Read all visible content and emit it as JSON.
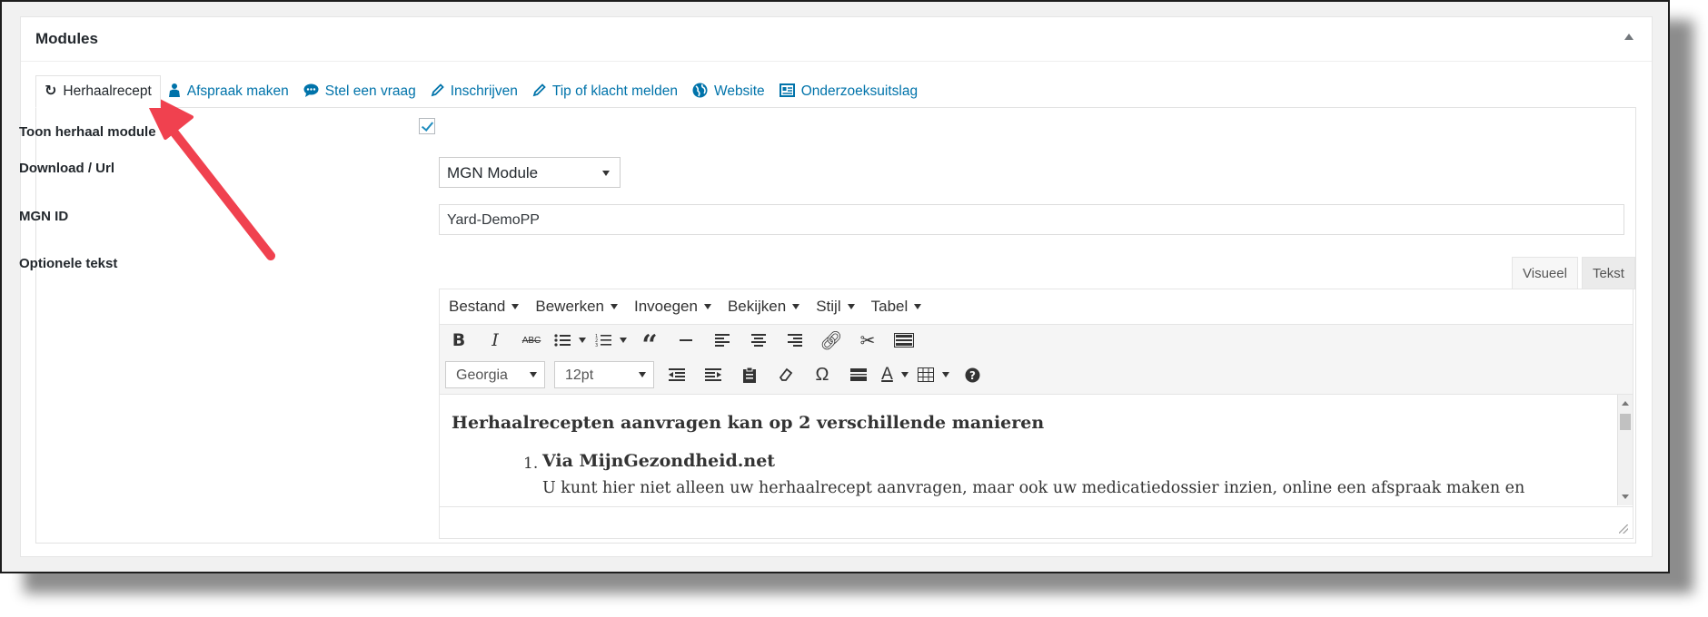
{
  "postbox": {
    "title": "Modules"
  },
  "tabs": [
    {
      "label": "Herhaalrecept",
      "icon": "refresh-icon"
    },
    {
      "label": "Afspraak maken",
      "icon": "person-icon"
    },
    {
      "label": "Stel een vraag",
      "icon": "chat-bubble-icon"
    },
    {
      "label": "Inschrijven",
      "icon": "pencil-icon"
    },
    {
      "label": "Tip of klacht melden",
      "icon": "pencil-icon"
    },
    {
      "label": "Website",
      "icon": "globe-icon"
    },
    {
      "label": "Onderzoeksuitslag",
      "icon": "document-icon"
    }
  ],
  "fields": {
    "toon": {
      "label": "Toon herhaal module",
      "checked": true
    },
    "download": {
      "label": "Download / Url",
      "value": "MGN Module"
    },
    "mgn_id": {
      "label": "MGN ID",
      "value": "Yard-DemoPP"
    },
    "optionele": {
      "label": "Optionele tekst"
    }
  },
  "editor": {
    "mode_tabs": [
      "Visueel",
      "Tekst"
    ],
    "menus": [
      "Bestand",
      "Bewerken",
      "Invoegen",
      "Bekijken",
      "Stijl",
      "Tabel"
    ],
    "font_family": "Georgia",
    "font_size": "12pt",
    "content": {
      "heading": "Herhaalrecepten aanvragen kan op 2 verschillende manieren",
      "list_number": "1.",
      "list_title": "Via MijnGezondheid.net",
      "list_text": "U kunt hier niet alleen uw herhaalrecept aanvragen, maar ook uw medicatiedossier inzien, online een afspraak maken en"
    }
  },
  "colors": {
    "accent": "#0073aa",
    "annotation_arrow": "#f0414f",
    "checkbox": "#1e8cbe"
  }
}
